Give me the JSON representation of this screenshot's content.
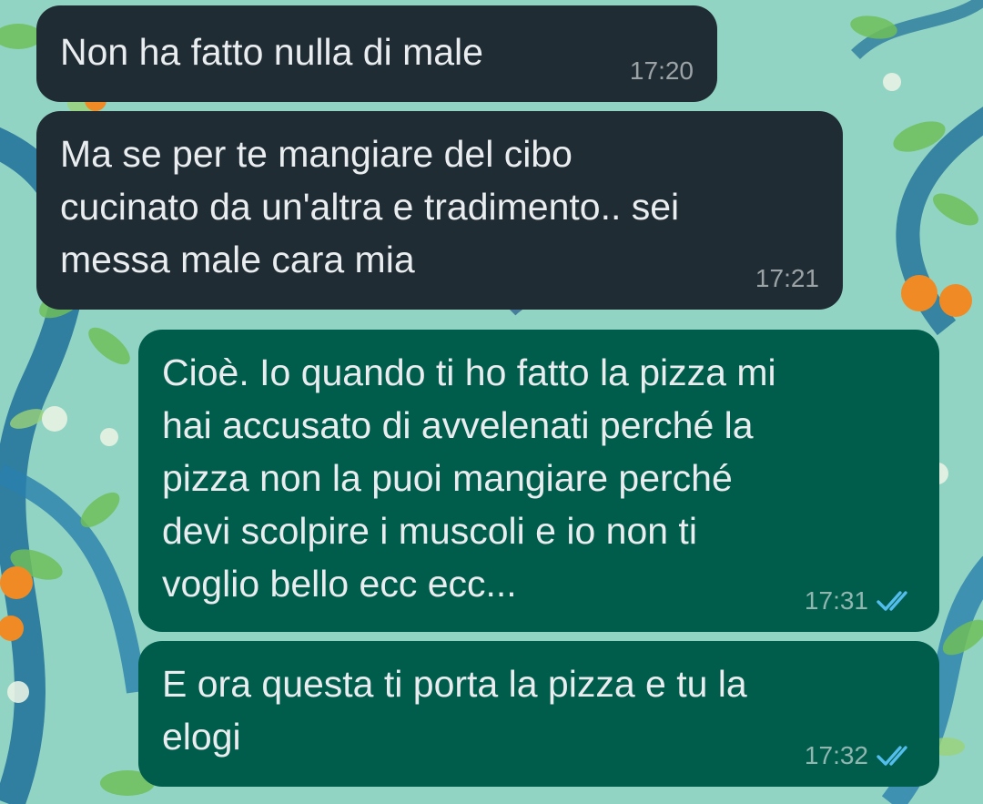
{
  "chat": {
    "wallpaper": {
      "type": "painted-tree-wallpaper",
      "colors": {
        "sky": "#7fc8b8",
        "branch": "#1f6f9a",
        "leaf": "#6fbf5a",
        "fruit": "#f08a24",
        "blossom": "#e8f2e4"
      }
    },
    "colors": {
      "incoming_bubble": "#202c33",
      "outgoing_bubble": "#005c4b",
      "text": "#e9edef",
      "read_tick": "#53bdeb"
    },
    "messages": [
      {
        "direction": "incoming",
        "text": "Non ha fatto nulla di male",
        "time": "17:20"
      },
      {
        "direction": "incoming",
        "text": "Ma se per te mangiare del cibo\ncucinato da un'altra e tradimento..  sei\nmessa male cara mia",
        "time": "17:21"
      },
      {
        "direction": "outgoing",
        "text": "Cioè. Io quando ti ho fatto la pizza mi\nhai accusato di avvelenati perché la\npizza non la puoi mangiare perché\ndevi scolpire i muscoli e io non ti\nvoglio bello ecc ecc...",
        "time": "17:31",
        "status": "read",
        "status_icon": "double-check-icon"
      },
      {
        "direction": "outgoing",
        "text": "E ora questa ti porta la pizza e tu la\nelogi",
        "time": "17:32",
        "status": "read",
        "status_icon": "double-check-icon"
      }
    ]
  }
}
